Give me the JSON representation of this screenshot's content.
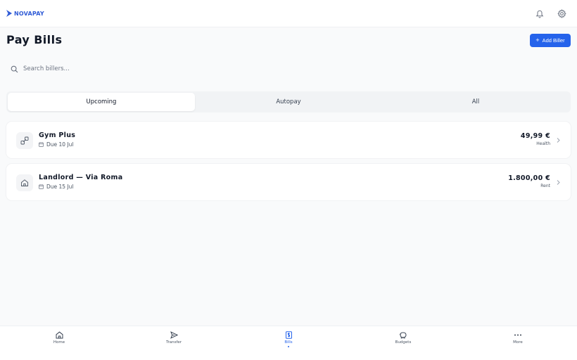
{
  "app": {
    "brand": "NOVAPAY"
  },
  "header": {
    "notifications_icon": "bell-icon",
    "settings_icon": "gear-icon"
  },
  "page": {
    "title": "Pay Bills",
    "add_button_label": "Add Biller"
  },
  "search": {
    "placeholder": "Search billers...",
    "value": ""
  },
  "tabs": [
    {
      "label": "Upcoming",
      "active": true
    },
    {
      "label": "Autopay",
      "active": false
    },
    {
      "label": "All",
      "active": false
    }
  ],
  "bills": [
    {
      "name": "Gym Plus",
      "due": "Due 10 Jul",
      "amount": "49,99 €",
      "category": "Health",
      "icon": "dumbbell-icon"
    },
    {
      "name": "Landlord — Via Roma",
      "due": "Due 15 Jul",
      "amount": "1.800,00 €",
      "category": "Rent",
      "icon": "home-icon"
    }
  ],
  "nav": [
    {
      "label": "Home",
      "icon": "home-icon",
      "active": false
    },
    {
      "label": "Transfer",
      "icon": "send-icon",
      "active": false
    },
    {
      "label": "Bills",
      "icon": "bill-icon",
      "active": true
    },
    {
      "label": "Budgets",
      "icon": "piggy-bank-icon",
      "active": false
    },
    {
      "label": "More",
      "icon": "more-icon",
      "active": false
    }
  ],
  "colors": {
    "accent": "#2563eb",
    "brand": "#2f5bd6"
  }
}
